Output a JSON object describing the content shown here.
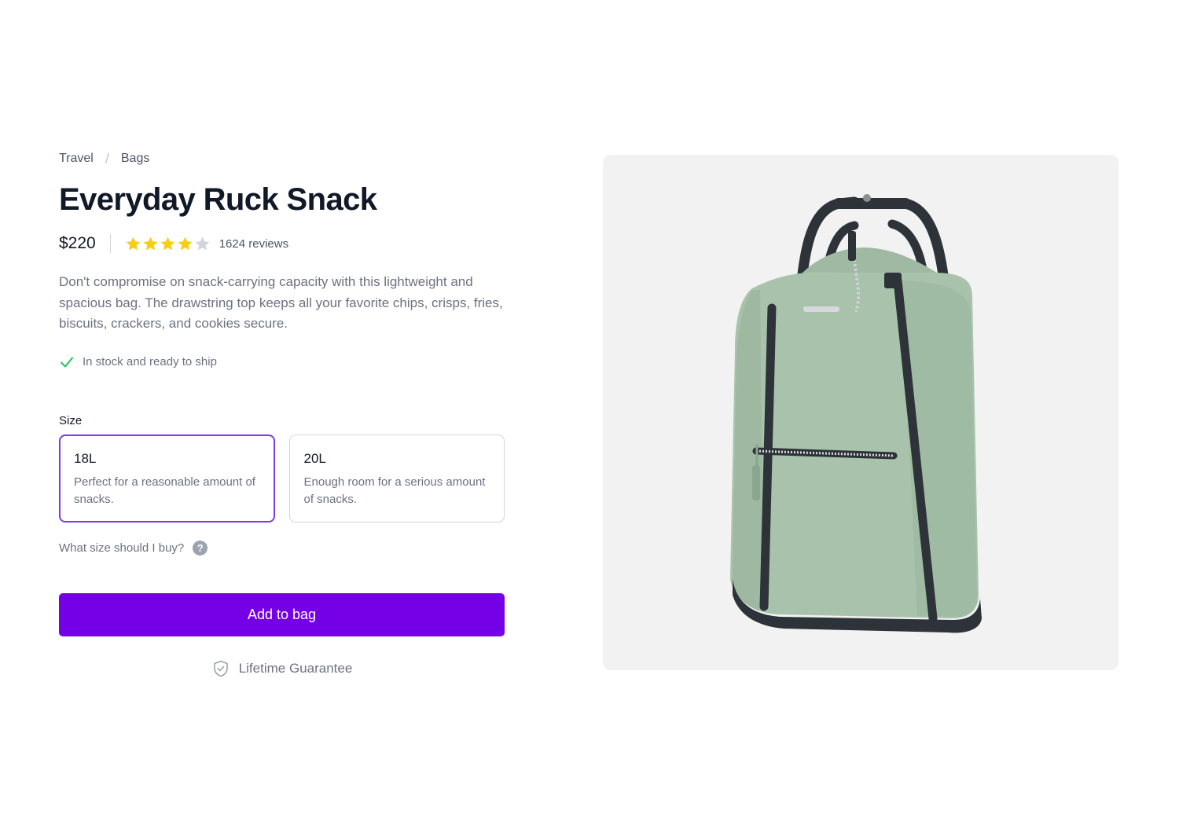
{
  "breadcrumb": {
    "items": [
      "Travel",
      "Bags"
    ],
    "separator": "/"
  },
  "product": {
    "title": "Everyday Ruck Snack",
    "price": "$220",
    "rating": 4,
    "rating_max": 5,
    "reviews": "1624 reviews",
    "description": "Don't compromise on snack-carrying capacity with this lightweight and spacious bag. The drawstring top keeps all your favorite chips, crisps, fries, biscuits, crackers, and cookies secure.",
    "stock": "In stock and ready to ship"
  },
  "size": {
    "label": "Size",
    "selected": "18L",
    "options": [
      {
        "name": "18L",
        "description": "Perfect for a reasonable amount of snacks."
      },
      {
        "name": "20L",
        "description": "Enough room for a serious amount of snacks."
      }
    ],
    "help": "What size should I buy?"
  },
  "actions": {
    "add_to_bag": "Add to bag",
    "guarantee": "Lifetime Guarantee"
  },
  "colors": {
    "accent": "#7500e8",
    "selected_border": "#7c3aed",
    "star": "#facc15",
    "star_empty": "#d1d5db",
    "in_stock": "#22c55e",
    "bag": "#a8c2ac"
  },
  "icons": {
    "stock": "check-icon",
    "help": "question-circle-icon",
    "guarantee": "shield-check-icon",
    "rating": "star-icon"
  }
}
